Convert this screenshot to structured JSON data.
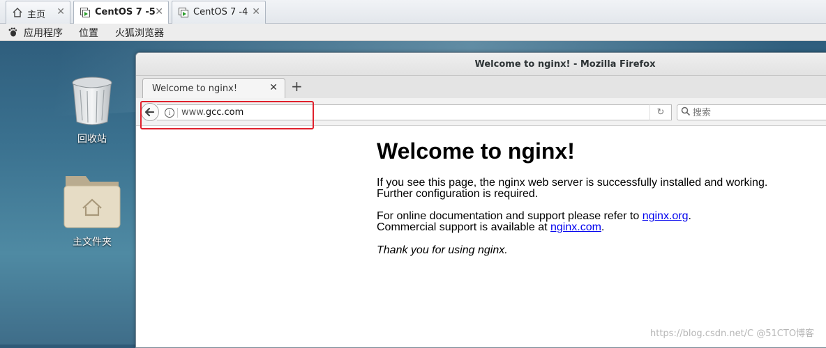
{
  "vmware": {
    "tabs": [
      {
        "label": "主页",
        "icon": "home-icon",
        "active": false
      },
      {
        "label": "CentOS 7 -5",
        "icon": "vm-icon",
        "active": true
      },
      {
        "label": "CentOS 7 -4",
        "icon": "vm-icon",
        "active": false
      }
    ]
  },
  "gnome": {
    "applications": "应用程序",
    "places": "位置",
    "firefox": "火狐浏览器"
  },
  "desktop": {
    "trash_label": "回收站",
    "home_label": "主文件夹"
  },
  "firefox": {
    "window_title": "Welcome to nginx! - Mozilla Firefox",
    "tab_title": "Welcome to nginx!",
    "url_prefix": "www.",
    "url_domain": "gcc.com",
    "search_placeholder": "搜索"
  },
  "page": {
    "heading": "Welcome to nginx!",
    "p1_line1": "If you see this page, the nginx web server is successfully installed and working.",
    "p1_line2": "Further configuration is required.",
    "p2_pre": "For online documentation and support please refer to ",
    "p2_link": "nginx.org",
    "p2_post": ".",
    "p3_pre": "Commercial support is available at ",
    "p3_link": "nginx.com",
    "p3_post": ".",
    "thanks": "Thank you for using nginx."
  },
  "watermark": "https://blog.csdn.net/C @51CTO博客",
  "colors": {
    "highlight": "#e0202c",
    "link": "#0000ee"
  }
}
